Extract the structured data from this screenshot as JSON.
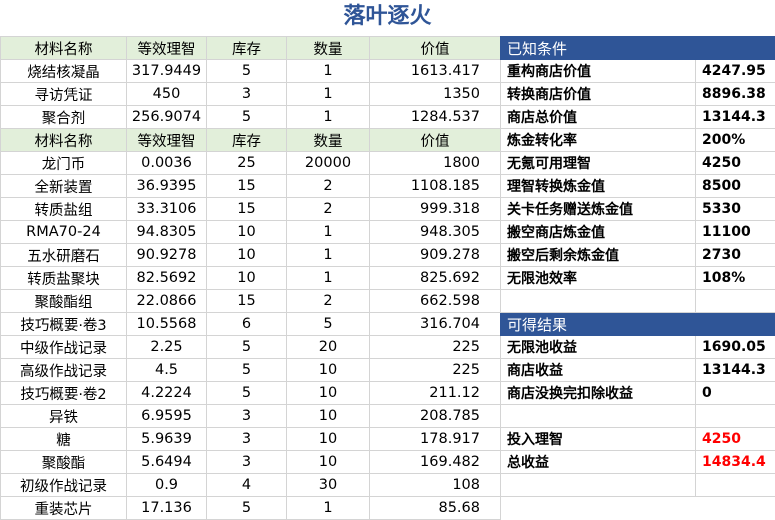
{
  "title": "落叶逐火",
  "headers": [
    "材料名称",
    "等效理智",
    "库存",
    "数量",
    "价值"
  ],
  "group1": [
    [
      "烧结核凝晶",
      "317.9449",
      "5",
      "1",
      "1613.417"
    ],
    [
      "寻访凭证",
      "450",
      "3",
      "1",
      "1350"
    ],
    [
      "聚合剂",
      "256.9074",
      "5",
      "1",
      "1284.537"
    ]
  ],
  "group2": [
    [
      "龙门币",
      "0.0036",
      "25",
      "20000",
      "1800"
    ],
    [
      "全新装置",
      "36.9395",
      "15",
      "2",
      "1108.185"
    ],
    [
      "转质盐组",
      "33.3106",
      "15",
      "2",
      "999.318"
    ],
    [
      "RMA70-24",
      "94.8305",
      "10",
      "1",
      "948.305"
    ],
    [
      "五水研磨石",
      "90.9278",
      "10",
      "1",
      "909.278"
    ],
    [
      "转质盐聚块",
      "82.5692",
      "10",
      "1",
      "825.692"
    ],
    [
      "聚酸酯组",
      "22.0866",
      "15",
      "2",
      "662.598"
    ],
    [
      "技巧概要·卷3",
      "10.5568",
      "6",
      "5",
      "316.704"
    ],
    [
      "中级作战记录",
      "2.25",
      "5",
      "20",
      "225"
    ],
    [
      "高级作战记录",
      "4.5",
      "5",
      "10",
      "225"
    ],
    [
      "技巧概要·卷2",
      "4.2224",
      "5",
      "10",
      "211.12"
    ],
    [
      "异铁",
      "6.9595",
      "3",
      "10",
      "208.785"
    ],
    [
      "糖",
      "5.9639",
      "3",
      "10",
      "178.917"
    ],
    [
      "聚酸酯",
      "5.6494",
      "3",
      "10",
      "169.482"
    ],
    [
      "初级作战记录",
      "0.9",
      "4",
      "30",
      "108"
    ],
    [
      "重装芯片",
      "17.136",
      "5",
      "1",
      "85.68"
    ]
  ],
  "known": {
    "header": "已知条件",
    "rows": [
      [
        "重构商店价值",
        "4247.95"
      ],
      [
        "转换商店价值",
        "8896.38"
      ],
      [
        "商店总价值",
        "13144.3"
      ],
      [
        "炼金转化率",
        "200%"
      ],
      [
        "无氪可用理智",
        "4250"
      ],
      [
        "理智转换炼金值",
        "8500"
      ],
      [
        "关卡任务赠送炼金值",
        "5330"
      ],
      [
        "搬空商店炼金值",
        "11100"
      ],
      [
        "搬空后剩余炼金值",
        "2730"
      ],
      [
        "无限池效率",
        "108%"
      ]
    ]
  },
  "results": {
    "header": "可得结果",
    "rows": [
      [
        "无限池收益",
        "1690.05"
      ],
      [
        "商店收益",
        "13144.3"
      ],
      [
        "商店没换完扣除收益",
        "0"
      ]
    ],
    "invest_label": "投入理智",
    "invest_value": "4250",
    "total_label": "总收益",
    "total_value": "14834.4"
  },
  "colors": {
    "title": "#2f5597",
    "header_bg": "#e2efda",
    "section_bg": "#2f5597",
    "highlight": "#ff0000"
  }
}
